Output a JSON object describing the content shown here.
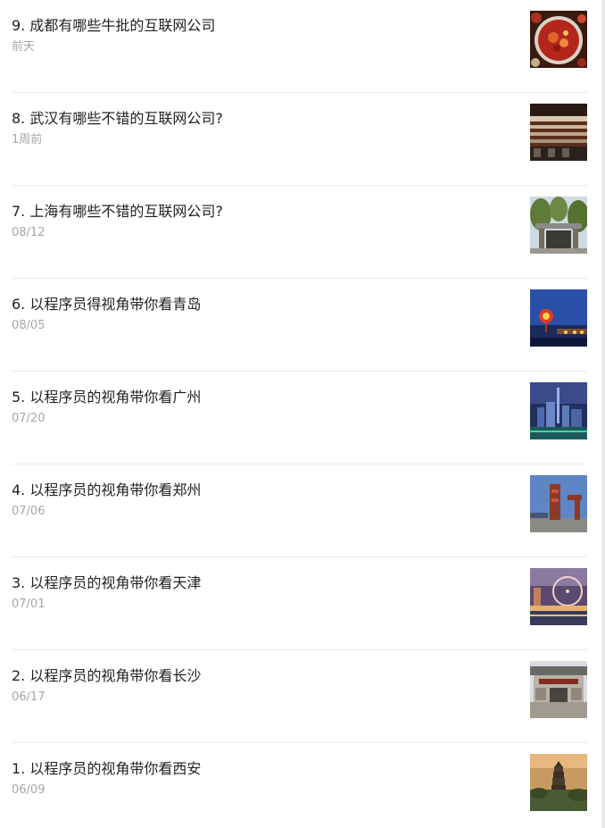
{
  "articles": [
    {
      "title": "9. 成都有哪些牛批的互联网公司",
      "date": "前天",
      "thumbnail": "hotpot-image"
    },
    {
      "title": "8. 武汉有哪些不错的互联网公司?",
      "date": "1周前",
      "thumbnail": "office-building-image"
    },
    {
      "title": "7. 上海有哪些不错的互联网公司?",
      "date": "08/12",
      "thumbnail": "campus-gate-image"
    },
    {
      "title": "6. 以程序员得视角带你看青岛",
      "date": "08/05",
      "thumbnail": "qingdao-night-image"
    },
    {
      "title": "5. 以程序员的视角带你看广州",
      "date": "07/20",
      "thumbnail": "guangzhou-skyline-image"
    },
    {
      "title": "4. 以程序员的视角带你看郑州",
      "date": "07/06",
      "thumbnail": "zhengzhou-monument-image"
    },
    {
      "title": "3. 以程序员的视角带你看天津",
      "date": "07/01",
      "thumbnail": "tianjin-eye-image"
    },
    {
      "title": "2. 以程序员的视角带你看长沙",
      "date": "06/17",
      "thumbnail": "changsha-building-image"
    },
    {
      "title": "1. 以程序员的视角带你看西安",
      "date": "06/09",
      "thumbnail": "xian-pagoda-image"
    }
  ]
}
